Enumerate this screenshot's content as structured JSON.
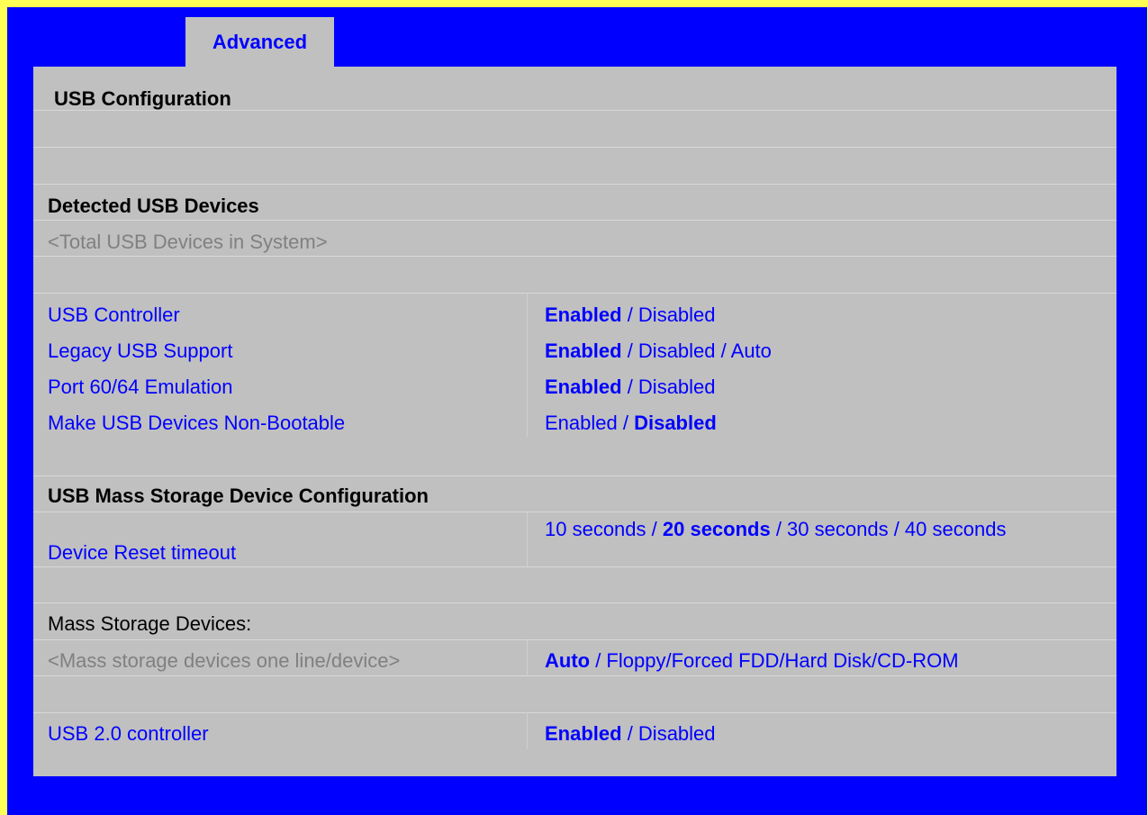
{
  "tab": {
    "label": "Advanced"
  },
  "page": {
    "title": "USB Configuration"
  },
  "detected": {
    "header": "Detected USB Devices",
    "total": "<Total USB Devices in System>"
  },
  "settings": [
    {
      "label": "USB Controller",
      "opt1": "Enabled",
      "rest": " / Disabled"
    },
    {
      "label": "Legacy USB Support",
      "opt1": "Enabled",
      "rest": " / Disabled / Auto"
    },
    {
      "label": "Port 60/64 Emulation",
      "opt1": "Enabled",
      "rest": " / Disabled"
    },
    {
      "label": "Make USB Devices Non-Bootable",
      "pre": "Enabled / ",
      "opt1": "Disabled"
    }
  ],
  "mass": {
    "header": "USB Mass Storage Device Configuration",
    "reset_label": "Device Reset timeout",
    "reset_pre": "10 seconds / ",
    "reset_bold": "20 seconds",
    "reset_post": " / 30 seconds / 40 seconds",
    "devices_header": "Mass Storage Devices:",
    "device_line": "<Mass storage devices one line/device>",
    "device_bold": "Auto",
    "device_rest": " / Floppy/Forced FDD/Hard Disk/CD-ROM"
  },
  "usb2": {
    "label": "USB 2.0 controller",
    "opt1": "Enabled",
    "rest": " / Disabled"
  }
}
